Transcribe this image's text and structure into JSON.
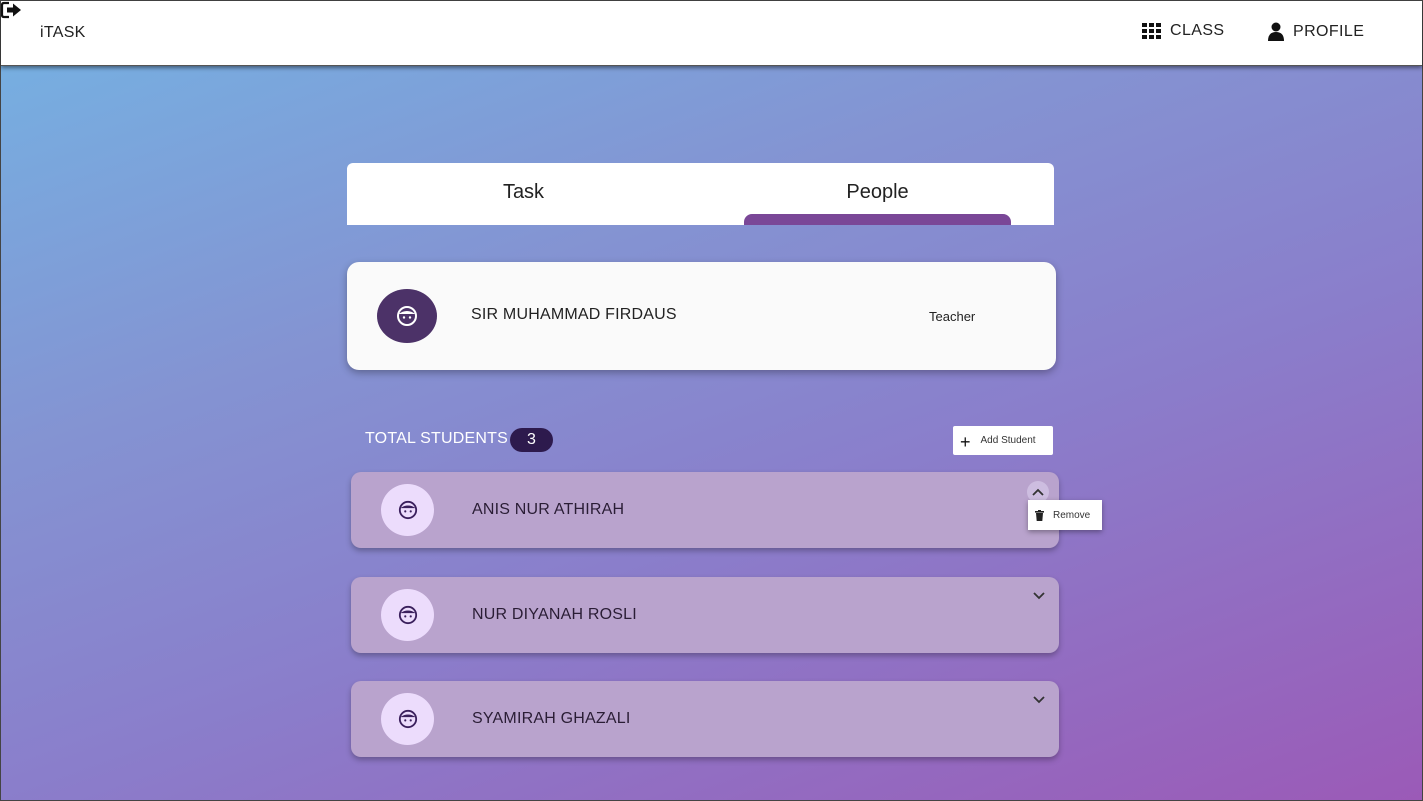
{
  "navbar": {
    "brand": "iTASK",
    "class_label": "CLASS",
    "profile_label": "PROFILE",
    "icons": {
      "class": "grid-icon",
      "profile": "user-icon",
      "logout": "logout-icon"
    }
  },
  "tabs": [
    {
      "label": "Task",
      "active": false
    },
    {
      "label": "People",
      "active": true
    }
  ],
  "teacher": {
    "name": "SIR MUHAMMAD FIRDAUS",
    "role": "Teacher",
    "avatar_icon": "face-icon"
  },
  "students_section": {
    "label": "TOTAL STUDENTS",
    "count": "3",
    "add_button": "Add Student"
  },
  "students": [
    {
      "name": "ANIS NUR ATHIRAH",
      "expanded": true
    },
    {
      "name": "NUR DIYANAH ROSLI",
      "expanded": false
    },
    {
      "name": "SYAMIRAH GHAZALI",
      "expanded": false
    }
  ],
  "student_menu": {
    "remove_label": "Remove",
    "icon": "trash-icon"
  },
  "colors": {
    "accent": "#7a4797",
    "teacher_avatar_bg": "#4c3268",
    "student_card_bg": "#b9a3cd",
    "badge_bg": "#2d1a4d"
  }
}
